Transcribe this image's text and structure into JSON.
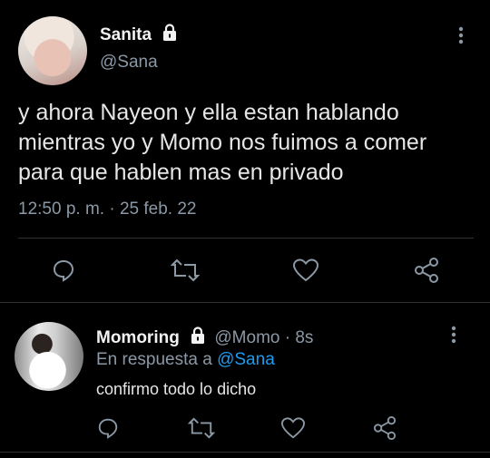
{
  "main_tweet": {
    "display_name": "Sanita",
    "handle": "@Sana",
    "text_lines": [
      "y ahora Nayeon y ella estan hablando",
      "mientras yo y Momo nos fuimos a comer",
      "para que hablen mas en privado"
    ],
    "timestamp": "12:50 p. m. · 25 feb. 22"
  },
  "reply": {
    "display_name": "Momoring",
    "handle": "@Momo",
    "age": "· 8s",
    "reply_prefix": "En respuesta a",
    "reply_to": "@Sana",
    "text": "confirmo todo lo dicho"
  },
  "icons": {
    "more": "more-vertical-icon",
    "lock": "lock-icon",
    "reply": "reply-icon",
    "retweet": "retweet-icon",
    "like": "heart-icon",
    "share": "share-icon"
  },
  "colors": {
    "background": "#000000",
    "text": "#d9d9d9",
    "muted": "#8b98a5",
    "link": "#1d9bf0",
    "divider": "#2f3336"
  }
}
